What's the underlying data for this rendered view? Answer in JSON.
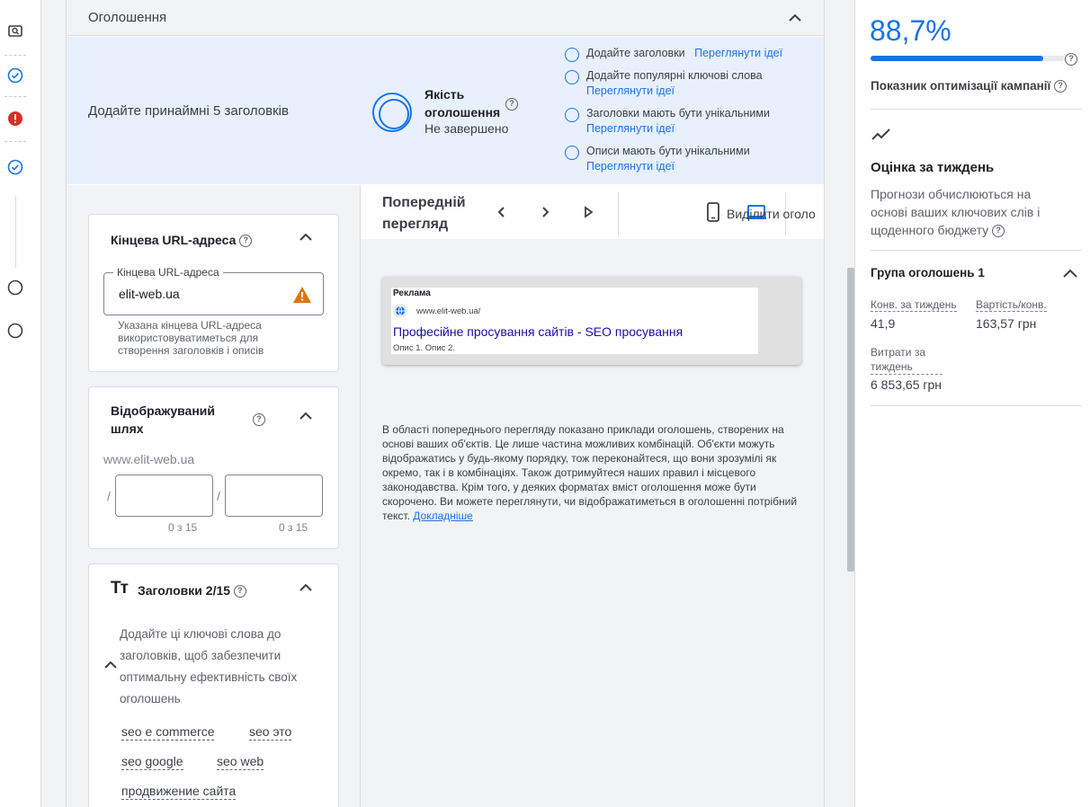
{
  "nav": {
    "icons": [
      "preview-icon",
      "check-circle-icon",
      "error-icon",
      "check-circle-icon",
      "empty-circle-icon",
      "empty-circle-icon"
    ]
  },
  "section": {
    "title": "Оголошення"
  },
  "quality": {
    "hint": "Додайте принаймні 5 заголовків",
    "label": "Якість оголошення",
    "state": "Не завершено",
    "tips": [
      {
        "text": "Додайте заголовки",
        "link": "Переглянути ідеї"
      },
      {
        "text": "Додайте популярні ключові слова",
        "link": "Переглянути ідеї"
      },
      {
        "text": "Заголовки мають бути унікальними",
        "link": "Переглянути ідеї"
      },
      {
        "text": "Описи мають бути унікальними",
        "link": "Переглянути ідеї"
      }
    ]
  },
  "final_url": {
    "title": "Кінцева URL-адреса",
    "field_label": "Кінцева URL-адреса",
    "value": "elit-web.ua",
    "helper": "Указана кінцева URL-адреса використовуватиметься для створення заголовків і описів"
  },
  "display_path": {
    "title": "Відображуваний шлях",
    "base": "www.elit-web.ua",
    "slash": "/",
    "count1": "0 з 15",
    "count2": "0 з 15"
  },
  "headlines": {
    "icon_text": "Tт",
    "title": "Заголовки 2/15",
    "hint": "Додайте ці ключові слова до заголовків, щоб забезпечити оптимальну ефективність своїх оголошень",
    "keywords": [
      "seo e commerce",
      "seo это",
      "seo google",
      "seo web",
      "продвижение сайта"
    ]
  },
  "preview": {
    "title": "Попередній перегляд",
    "highlight": "Виділити оголо",
    "ad": {
      "label": "Реклама",
      "url": "www.elit-web.ua/",
      "headline": "Професійне просування сайтів - SEO просування",
      "description": "Опис 1. Опис 2."
    },
    "note": "В області попереднього перегляду показано приклади оголошень, створених на основі ваших об'єктів. Це лише частина можливих комбінацій. Об'єкти можуть відображатись у будь-якому порядку, тож переконайтеся, що вони зрозумілі як окремо, так і в комбінаціях. Також дотримуйтеся наших правил і місцевого законодавства. Крім того, у деяких форматах вміст оголошення може бути скорочено. Ви можете переглянути, чи відображатиметься в оголошенні потрібний текст.",
    "note_link": "Докладніше"
  },
  "optimization": {
    "score": "88,7%",
    "progress": 0.887,
    "label": "Показник оптимізації кампанії"
  },
  "weekly": {
    "title": "Оцінка за тиждень",
    "subtitle": "Прогнози обчислюються на основі ваших ключових слів і щоденного бюджету"
  },
  "ad_group": {
    "title": "Група оголошень 1",
    "metrics": [
      {
        "label": "Конв. за тиждень",
        "value": "41,9"
      },
      {
        "label": "Вартість/конв.",
        "value": "163,57 грн"
      },
      {
        "label": "Витрати за тиждень",
        "value": "6 853,65 грн"
      }
    ]
  },
  "colors": {
    "accent": "#1a73e8",
    "error": "#d93025",
    "warning": "#e37400",
    "quality_bg": "#e8f0fe"
  }
}
